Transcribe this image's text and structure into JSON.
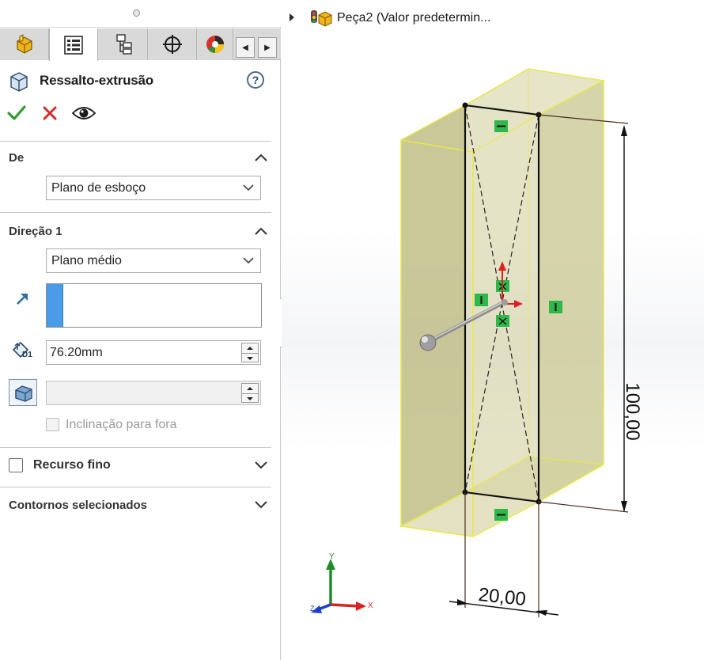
{
  "feature": {
    "title": "Ressalto-extrusão",
    "help_label": "?"
  },
  "sections": {
    "from": {
      "title": "De",
      "start_condition": "Plano de esboço"
    },
    "direction1": {
      "title": "Direção 1",
      "end_condition": "Plano médio",
      "depth_value": "76.20mm",
      "depth_icon_label": "D1",
      "draft_outward_label": "Inclinação para fora"
    },
    "thin_feature": {
      "title": "Recurso fino",
      "checked": false
    },
    "selected_contours": {
      "title": "Contornos selecionados"
    }
  },
  "tree": {
    "part_name": "Peça2 (Valor predetermin..."
  },
  "model": {
    "dimension_height": "100,00",
    "dimension_width": "20,00",
    "triad_x_label": "X",
    "triad_y_label": "Y",
    "triad_z_label": "Z"
  },
  "colors": {
    "preview_fill": "#c9c58a",
    "preview_edge": "#e8e84a",
    "selection_blue": "#4a9be8",
    "ok_green": "#2f9a2f",
    "cancel_red": "#d42a2a"
  },
  "icons": {
    "tabs": [
      "feature-manager-icon",
      "property-manager-icon",
      "configuration-manager-icon",
      "dimxpert-icon",
      "display-manager-icon"
    ],
    "ok": "checkmark-icon",
    "cancel": "close-icon",
    "preview": "eye-icon"
  }
}
